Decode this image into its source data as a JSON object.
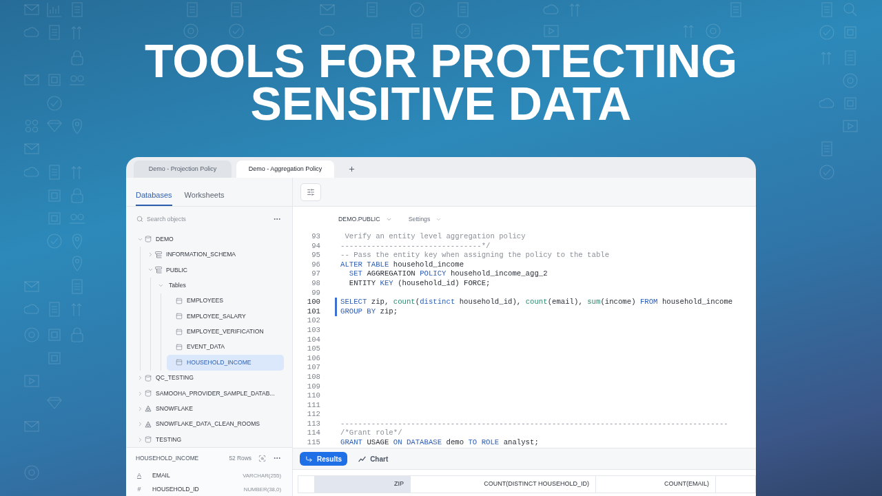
{
  "banner": {
    "title": "TOOLS FOR PROTECTING SENSITIVE DATA"
  },
  "window": {
    "tabs": [
      {
        "label": "Demo - Projection Policy",
        "selected": false
      },
      {
        "label": "Demo - Aggregation Policy",
        "selected": true
      }
    ]
  },
  "sidebar": {
    "tabs": [
      {
        "label": "Databases",
        "selected": true
      },
      {
        "label": "Worksheets",
        "selected": false
      }
    ],
    "search": {
      "placeholder": "Search objects"
    },
    "tree": [
      {
        "label": "DEMO",
        "kind": "database",
        "expanded": true,
        "selected": false,
        "children": [
          {
            "label": "INFORMATION_SCHEMA",
            "kind": "schema",
            "expanded": false,
            "selected": false
          },
          {
            "label": "PUBLIC",
            "kind": "schema",
            "expanded": true,
            "selected": false,
            "children": [
              {
                "label": "Tables",
                "kind": "folder",
                "expanded": true,
                "selected": false,
                "children": [
                  {
                    "label": "EMPLOYEES",
                    "kind": "table",
                    "selected": false
                  },
                  {
                    "label": "EMPLOYEE_SALARY",
                    "kind": "table",
                    "selected": false
                  },
                  {
                    "label": "EMPLOYEE_VERIFICATION",
                    "kind": "table",
                    "selected": false
                  },
                  {
                    "label": "EVENT_DATA",
                    "kind": "table",
                    "selected": false
                  },
                  {
                    "label": "HOUSEHOLD_INCOME",
                    "kind": "table",
                    "selected": true
                  }
                ]
              }
            ]
          }
        ]
      },
      {
        "label": "QC_TESTING",
        "kind": "database",
        "expanded": false,
        "selected": false
      },
      {
        "label": "SAMOOHA_PROVIDER_SAMPLE_DATAB...",
        "kind": "database",
        "expanded": false,
        "selected": false
      },
      {
        "label": "SNOWFLAKE",
        "kind": "shared",
        "expanded": false,
        "selected": false
      },
      {
        "label": "SNOWFLAKE_DATA_CLEAN_ROOMS",
        "kind": "shared",
        "expanded": false,
        "selected": false
      },
      {
        "label": "TESTING",
        "kind": "database",
        "expanded": false,
        "selected": false
      }
    ],
    "details": {
      "title": "HOUSEHOLD_INCOME",
      "row_count": "52 Rows",
      "columns": [
        {
          "symbol": "A",
          "kind": "text",
          "name": "EMAIL",
          "type": "VARCHAR(255)"
        },
        {
          "symbol": "#",
          "kind": "number",
          "name": "HOUSEHOLD_ID",
          "type": "NUMBER(38,0)"
        }
      ]
    }
  },
  "editor": {
    "context": {
      "database": "DEMO.PUBLIC",
      "settings": "Settings"
    },
    "lines": [
      {
        "number": "93",
        "active": false,
        "tokens": [
          {
            "text": " Verify an entity level aggregation policy",
            "kind": "comment"
          }
        ]
      },
      {
        "number": "94",
        "active": false,
        "tokens": [
          {
            "text": "--------------------------------*/",
            "kind": "comment"
          }
        ]
      },
      {
        "number": "95",
        "active": false,
        "tokens": [
          {
            "text": "-- Pass the entity key when assigning the policy to the table",
            "kind": "comment"
          }
        ]
      },
      {
        "number": "96",
        "active": false,
        "tokens": [
          {
            "text": "ALTER TABLE",
            "kind": "keyword"
          },
          {
            "text": " household_income",
            "kind": "plain"
          }
        ]
      },
      {
        "number": "97",
        "active": false,
        "tokens": [
          {
            "text": "  SET",
            "kind": "keyword"
          },
          {
            "text": " AGGREGATION ",
            "kind": "plain"
          },
          {
            "text": "POLICY",
            "kind": "keyword"
          },
          {
            "text": " household_income_agg_2",
            "kind": "plain"
          }
        ]
      },
      {
        "number": "98",
        "active": false,
        "tokens": [
          {
            "text": "  ENTITY ",
            "kind": "plain"
          },
          {
            "text": "KEY",
            "kind": "keyword"
          },
          {
            "text": " (household_id) FORCE;",
            "kind": "plain"
          }
        ]
      },
      {
        "number": "99",
        "active": false
      },
      {
        "number": "100",
        "active": true,
        "tokens": [
          {
            "text": "SELECT",
            "kind": "keyword"
          },
          {
            "text": " zip, ",
            "kind": "plain"
          },
          {
            "text": "count",
            "kind": "function"
          },
          {
            "text": "(",
            "kind": "plain"
          },
          {
            "text": "distinct",
            "kind": "keyword"
          },
          {
            "text": " household_id), ",
            "kind": "plain"
          },
          {
            "text": "count",
            "kind": "function"
          },
          {
            "text": "(email), ",
            "kind": "plain"
          },
          {
            "text": "sum",
            "kind": "function"
          },
          {
            "text": "(income) ",
            "kind": "plain"
          },
          {
            "text": "FROM",
            "kind": "keyword"
          },
          {
            "text": " household_income",
            "kind": "plain"
          }
        ]
      },
      {
        "number": "101",
        "active": true,
        "tokens": [
          {
            "text": "GROUP BY",
            "kind": "keyword"
          },
          {
            "text": " zip;",
            "kind": "plain"
          }
        ]
      },
      {
        "number": "102",
        "active": false
      },
      {
        "number": "103",
        "active": false
      },
      {
        "number": "104",
        "active": false
      },
      {
        "number": "105",
        "active": false
      },
      {
        "number": "106",
        "active": false
      },
      {
        "number": "107",
        "active": false
      },
      {
        "number": "108",
        "active": false
      },
      {
        "number": "109",
        "active": false
      },
      {
        "number": "110",
        "active": false
      },
      {
        "number": "111",
        "active": false
      },
      {
        "number": "112",
        "active": false
      },
      {
        "number": "113",
        "active": false,
        "tokens": [
          {
            "text": "----------------------------------------------------------------------------------------",
            "kind": "comment"
          }
        ]
      },
      {
        "number": "114",
        "active": false,
        "tokens": [
          {
            "text": "/*Grant role*/",
            "kind": "comment"
          }
        ]
      },
      {
        "number": "115",
        "active": false,
        "tokens": [
          {
            "text": "GRANT",
            "kind": "keyword"
          },
          {
            "text": " USAGE ",
            "kind": "plain"
          },
          {
            "text": "ON DATABASE",
            "kind": "keyword"
          },
          {
            "text": " demo ",
            "kind": "plain"
          },
          {
            "text": "TO ROLE",
            "kind": "keyword"
          },
          {
            "text": " analyst;",
            "kind": "plain"
          }
        ]
      }
    ]
  },
  "results": {
    "tabs": [
      {
        "label": "Results",
        "kind": "results",
        "selected": true
      },
      {
        "label": "Chart",
        "kind": "chart",
        "selected": false
      }
    ],
    "columns": [
      {
        "label": "ZIP",
        "selected": true
      },
      {
        "label": "COUNT(DISTINCT HOUSEHOLD_ID)",
        "selected": false
      },
      {
        "label": "COUNT(EMAIL)",
        "selected": false
      }
    ]
  }
}
